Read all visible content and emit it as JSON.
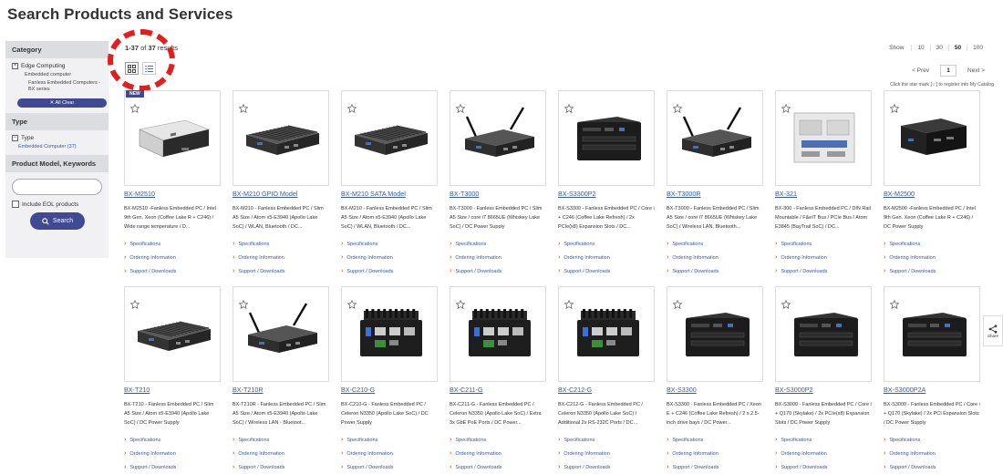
{
  "page_title": "Search Products and Services",
  "sidebar": {
    "category_heading": "Category",
    "category_item": "Edge Computing",
    "category_sub": "Embedded computer",
    "category_sub2": "Fanless Embedded Computers - BX series",
    "all_clear": "All Clear",
    "type_heading": "Type",
    "type_item": "Type",
    "type_link": "Embedded Computer (37)",
    "keywords_heading": "Product Model, Keywords",
    "include_eol": "Include EOL products",
    "search_button": "Search"
  },
  "results": {
    "range": "1-37",
    "of": "of",
    "total": "37",
    "suffix": "results",
    "show_label": "Show",
    "show_options": [
      "10",
      "30",
      "50",
      "100"
    ],
    "show_selected": "50",
    "prev": "< Prev",
    "page": "1",
    "next": "Next >",
    "star_note": "Click the star mark [☆] to register into My Catalog"
  },
  "link_labels": {
    "spec": "Specifications",
    "order": "Ordering Information",
    "support": "Support / Downloads"
  },
  "new_badge": "NEW",
  "share_label": "Share",
  "accent_color": "#3f4a92",
  "link_color": "#3758a8",
  "products": [
    {
      "model": "BX-M2510",
      "desc": "BX-M2510 -Fanless Embedded PC / Intel 9th Gen. Xeon (Coffee Lake R + C246) / Wide range temperature / D...",
      "new": true
    },
    {
      "model": "BX-M210 GPIO Model",
      "desc": "BX-M210 - Fanless Embedded PC / Slim A5 Size / Atom x5-E3940 (Apollo Lake SoC) / WLAN, Bluetooth / DC..."
    },
    {
      "model": "BX-M210 SATA Model",
      "desc": "BX-M210 - Fanless Embedded PC / Slim A5 Size / Atom x5-E3940 (Apollo Lake SoC) / WLAN, Bluetooth / DC..."
    },
    {
      "model": "BX-T3000",
      "desc": "BX-T3000 - Fanless Embedded PC / Slim A5 Size / core i7 8665UE (Whiskey Lake SoC) / DC Power Supply"
    },
    {
      "model": "BX-S3300P2",
      "desc": "BX-S3300 - Fanless Embedded PC / Core i + C246 (Coffee Lake Refresh) / 2x PCIe(x8) Expansion Slots / DC..."
    },
    {
      "model": "BX-T3000R",
      "desc": "BX-T3000 - Fanless Embedded PC / Slim A5 Size / core i7 8665UE (Whiskey Lake SoC) / Wireless LAN, Bluetooth..."
    },
    {
      "model": "BX-321",
      "desc": "BX-300 - Fanless Embedded PC / DIN Rail Mountable / F&eIT Bus / PCIe Bus / Atom E3845 (BayTrail SoC) / DC..."
    },
    {
      "model": "BX-M2500",
      "desc": "BX-M2500 -Fanless Embedded PC / Intel 9th Gen. Xeon (Coffee Lake R + C246) / DC Power Supply"
    },
    {
      "model": "BX-T210",
      "desc": "BX-T210 - Fanless Embedded PC / Slim A5 Size / Atom x5-E3940 (Apollo Lake SoC) / DC Power Supply"
    },
    {
      "model": "BX-T210R",
      "desc": "BX-T210R - Fanless Embedded PC / Slim A5 Size / Atom x5-E3940 (Apollo Lake SoC) / Wireless LAN - Bluetoot..."
    },
    {
      "model": "BX-C210-G",
      "desc": "BX-C210-G - Fanless Embedded PC / Celeron N3350 (Apollo Lake SoC) / DC Power Supply"
    },
    {
      "model": "BX-C211-G",
      "desc": "BX-C211-G - Fanless Embedded PC / Celeron N3350 (Apollo Lake SoC) / Extra 3x GbE PoE Ports / DC Power..."
    },
    {
      "model": "BX-C212-G",
      "desc": "BX-C212-G - Fanless Embedded PC / Celeron N3350 (Apollo Lake SoC) / Additional 2x RS-232C Ports / DC..."
    },
    {
      "model": "BX-S3300",
      "desc": "BX-S3300 - Fanless Embedded PC / Xeon E + C246 (Coffee Lake Refresh) / 2 x 2.5-inch drive bays / DC Power..."
    },
    {
      "model": "BX-S3000P2",
      "desc": "BX-S3000 - Fanless Embedded PC / Core i + Q170 (Skylake) / 2x PCIe(x8) Expansion Slots / DC Power Supply"
    },
    {
      "model": "BX-S3000P2A",
      "desc": "BX-S3000 - Fanless Embedded PC / Core i + Q170 (Skylake) / 2x PCI Expansion Slots / DC Power Supply"
    }
  ]
}
